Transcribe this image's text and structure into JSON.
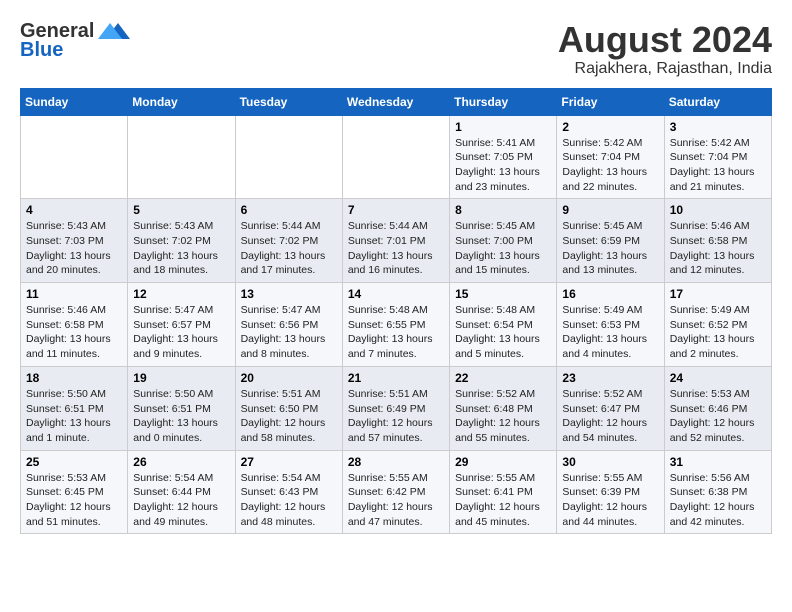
{
  "header": {
    "logo_line1": "General",
    "logo_line2": "Blue",
    "main_title": "August 2024",
    "sub_title": "Rajakhera, Rajasthan, India"
  },
  "days_of_week": [
    "Sunday",
    "Monday",
    "Tuesday",
    "Wednesday",
    "Thursday",
    "Friday",
    "Saturday"
  ],
  "weeks": [
    [
      {
        "day": "",
        "info": ""
      },
      {
        "day": "",
        "info": ""
      },
      {
        "day": "",
        "info": ""
      },
      {
        "day": "",
        "info": ""
      },
      {
        "day": "1",
        "info": "Sunrise: 5:41 AM\nSunset: 7:05 PM\nDaylight: 13 hours\nand 23 minutes."
      },
      {
        "day": "2",
        "info": "Sunrise: 5:42 AM\nSunset: 7:04 PM\nDaylight: 13 hours\nand 22 minutes."
      },
      {
        "day": "3",
        "info": "Sunrise: 5:42 AM\nSunset: 7:04 PM\nDaylight: 13 hours\nand 21 minutes."
      }
    ],
    [
      {
        "day": "4",
        "info": "Sunrise: 5:43 AM\nSunset: 7:03 PM\nDaylight: 13 hours\nand 20 minutes."
      },
      {
        "day": "5",
        "info": "Sunrise: 5:43 AM\nSunset: 7:02 PM\nDaylight: 13 hours\nand 18 minutes."
      },
      {
        "day": "6",
        "info": "Sunrise: 5:44 AM\nSunset: 7:02 PM\nDaylight: 13 hours\nand 17 minutes."
      },
      {
        "day": "7",
        "info": "Sunrise: 5:44 AM\nSunset: 7:01 PM\nDaylight: 13 hours\nand 16 minutes."
      },
      {
        "day": "8",
        "info": "Sunrise: 5:45 AM\nSunset: 7:00 PM\nDaylight: 13 hours\nand 15 minutes."
      },
      {
        "day": "9",
        "info": "Sunrise: 5:45 AM\nSunset: 6:59 PM\nDaylight: 13 hours\nand 13 minutes."
      },
      {
        "day": "10",
        "info": "Sunrise: 5:46 AM\nSunset: 6:58 PM\nDaylight: 13 hours\nand 12 minutes."
      }
    ],
    [
      {
        "day": "11",
        "info": "Sunrise: 5:46 AM\nSunset: 6:58 PM\nDaylight: 13 hours\nand 11 minutes."
      },
      {
        "day": "12",
        "info": "Sunrise: 5:47 AM\nSunset: 6:57 PM\nDaylight: 13 hours\nand 9 minutes."
      },
      {
        "day": "13",
        "info": "Sunrise: 5:47 AM\nSunset: 6:56 PM\nDaylight: 13 hours\nand 8 minutes."
      },
      {
        "day": "14",
        "info": "Sunrise: 5:48 AM\nSunset: 6:55 PM\nDaylight: 13 hours\nand 7 minutes."
      },
      {
        "day": "15",
        "info": "Sunrise: 5:48 AM\nSunset: 6:54 PM\nDaylight: 13 hours\nand 5 minutes."
      },
      {
        "day": "16",
        "info": "Sunrise: 5:49 AM\nSunset: 6:53 PM\nDaylight: 13 hours\nand 4 minutes."
      },
      {
        "day": "17",
        "info": "Sunrise: 5:49 AM\nSunset: 6:52 PM\nDaylight: 13 hours\nand 2 minutes."
      }
    ],
    [
      {
        "day": "18",
        "info": "Sunrise: 5:50 AM\nSunset: 6:51 PM\nDaylight: 13 hours\nand 1 minute."
      },
      {
        "day": "19",
        "info": "Sunrise: 5:50 AM\nSunset: 6:51 PM\nDaylight: 13 hours\nand 0 minutes."
      },
      {
        "day": "20",
        "info": "Sunrise: 5:51 AM\nSunset: 6:50 PM\nDaylight: 12 hours\nand 58 minutes."
      },
      {
        "day": "21",
        "info": "Sunrise: 5:51 AM\nSunset: 6:49 PM\nDaylight: 12 hours\nand 57 minutes."
      },
      {
        "day": "22",
        "info": "Sunrise: 5:52 AM\nSunset: 6:48 PM\nDaylight: 12 hours\nand 55 minutes."
      },
      {
        "day": "23",
        "info": "Sunrise: 5:52 AM\nSunset: 6:47 PM\nDaylight: 12 hours\nand 54 minutes."
      },
      {
        "day": "24",
        "info": "Sunrise: 5:53 AM\nSunset: 6:46 PM\nDaylight: 12 hours\nand 52 minutes."
      }
    ],
    [
      {
        "day": "25",
        "info": "Sunrise: 5:53 AM\nSunset: 6:45 PM\nDaylight: 12 hours\nand 51 minutes."
      },
      {
        "day": "26",
        "info": "Sunrise: 5:54 AM\nSunset: 6:44 PM\nDaylight: 12 hours\nand 49 minutes."
      },
      {
        "day": "27",
        "info": "Sunrise: 5:54 AM\nSunset: 6:43 PM\nDaylight: 12 hours\nand 48 minutes."
      },
      {
        "day": "28",
        "info": "Sunrise: 5:55 AM\nSunset: 6:42 PM\nDaylight: 12 hours\nand 47 minutes."
      },
      {
        "day": "29",
        "info": "Sunrise: 5:55 AM\nSunset: 6:41 PM\nDaylight: 12 hours\nand 45 minutes."
      },
      {
        "day": "30",
        "info": "Sunrise: 5:55 AM\nSunset: 6:39 PM\nDaylight: 12 hours\nand 44 minutes."
      },
      {
        "day": "31",
        "info": "Sunrise: 5:56 AM\nSunset: 6:38 PM\nDaylight: 12 hours\nand 42 minutes."
      }
    ]
  ]
}
